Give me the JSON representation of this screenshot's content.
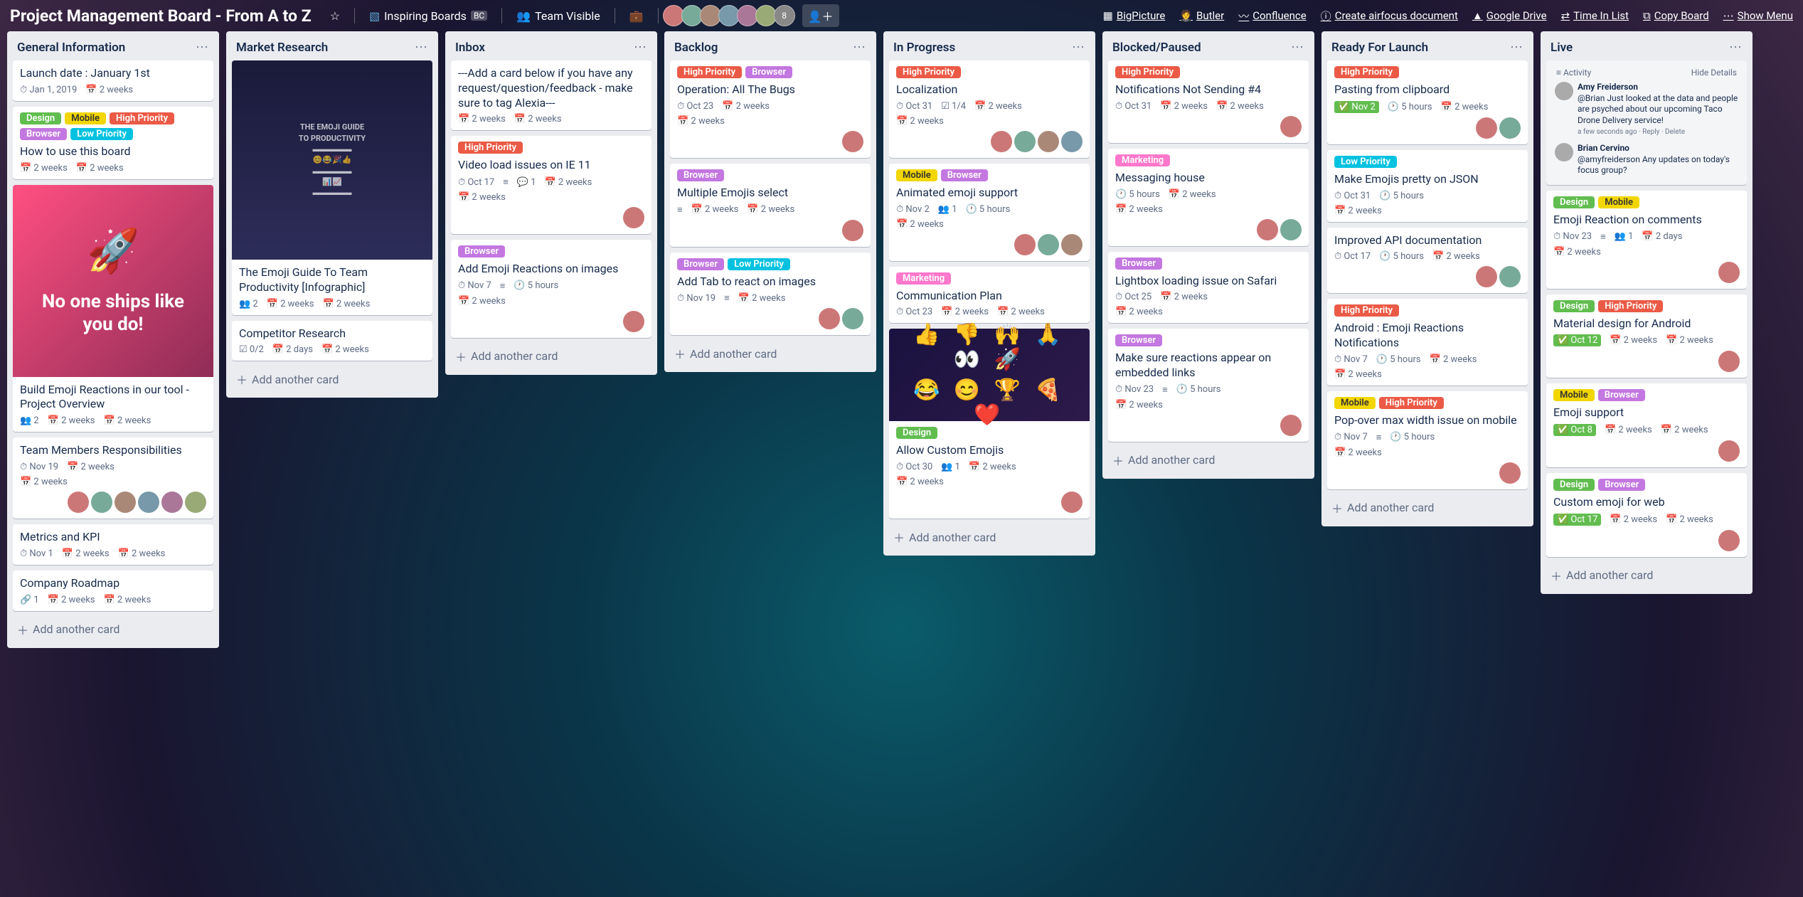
{
  "header": {
    "title": "Project Management Board - From A to Z",
    "team_label": "Inspiring Boards",
    "team_badge": "BC",
    "visibility": "Team Visible",
    "member_count_badge": "8",
    "links": [
      "BigPicture",
      "Butler",
      "Confluence",
      "Create airfocus document",
      "Google Drive",
      "Time In List",
      "Copy Board"
    ],
    "show_menu": "Show Menu"
  },
  "add_label": "Add another card",
  "lists": [
    {
      "title": "General Information",
      "cards": [
        {
          "title": "Launch date : January 1st",
          "badges": [
            "⏱ Jan 1, 2019",
            "📅 2 weeks"
          ]
        },
        {
          "labels": [
            "design",
            "mobile",
            "highpriority",
            "browser",
            "lowpriority"
          ],
          "title": "How to use this board",
          "badges": [
            "📅 2 weeks",
            "📅 2 weeks"
          ]
        },
        {
          "cover": "rocket",
          "cover_text": "No one ships like you do!",
          "title": "Build Emoji Reactions in our tool - Project Overview",
          "badges": [
            "👥 2",
            "📅 2 weeks",
            "📅 2 weeks"
          ]
        },
        {
          "title": "Team Members Responsibilities",
          "badges": [
            "⏱ Nov 19",
            "📅 2 weeks"
          ],
          "badges2": [
            "📅 2 weeks"
          ],
          "members": 6
        },
        {
          "title": "Metrics and KPI",
          "badges": [
            "⏱ Nov 1",
            "📅 2 weeks",
            "📅 2 weeks"
          ]
        },
        {
          "title": "Company Roadmap",
          "badges": [
            "🔗 1",
            "📅 2 weeks",
            "📅 2 weeks"
          ]
        }
      ]
    },
    {
      "title": "Market Research",
      "cards": [
        {
          "cover": "info",
          "title": "The Emoji Guide To Team Productivity [Infographic]",
          "badges": [
            "👥 2",
            "📅 2 weeks",
            "📅 2 weeks"
          ]
        },
        {
          "title": "Competitor Research",
          "badges": [
            "☑ 0/2",
            "📅 2 days",
            "📅 2 weeks"
          ]
        }
      ]
    },
    {
      "title": "Inbox",
      "cards": [
        {
          "title": "---Add a card below if you have any request/question/feedback - make sure to tag Alexia---",
          "badges": [
            "📅 2 weeks",
            "📅 2 weeks"
          ]
        },
        {
          "labels": [
            "highpriority"
          ],
          "title": "Video load issues on IE 11",
          "badges": [
            "⏱ Oct 17",
            "≡",
            "💬 1",
            "📅 2 weeks"
          ],
          "badges2": [
            "📅 2 weeks"
          ],
          "members": 1
        },
        {
          "labels": [
            "browser"
          ],
          "title": "Add Emoji Reactions on images",
          "badges": [
            "⏱ Nov 7",
            "≡",
            "🕐 5 hours"
          ],
          "badges2": [
            "📅 2 weeks"
          ],
          "members": 1
        }
      ]
    },
    {
      "title": "Backlog",
      "cards": [
        {
          "labels": [
            "highpriority",
            "browser"
          ],
          "title": "Operation: All The Bugs",
          "badges": [
            "⏱ Oct 23",
            "📅 2 weeks"
          ],
          "badges2": [
            "📅 2 weeks"
          ],
          "members": 1
        },
        {
          "labels": [
            "browser"
          ],
          "title": "Multiple Emojis select",
          "badges": [
            "≡",
            "📅 2 weeks",
            "📅 2 weeks"
          ],
          "members": 1
        },
        {
          "labels": [
            "browser",
            "lowpriority"
          ],
          "title": "Add Tab to react on images",
          "badges": [
            "⏱ Nov 19",
            "≡",
            "📅 2 weeks"
          ],
          "members": 2
        }
      ]
    },
    {
      "title": "In Progress",
      "cards": [
        {
          "labels": [
            "highpriority"
          ],
          "title": "Localization",
          "badges": [
            "⏱ Oct 31",
            "☑ 1/4",
            "📅 2 weeks"
          ],
          "badges2": [
            "📅 2 weeks"
          ],
          "members": 4
        },
        {
          "labels": [
            "mobile",
            "browser"
          ],
          "title": "Animated emoji support",
          "badges": [
            "⏱ Nov 2",
            "👥 1",
            "🕐 5 hours"
          ],
          "badges2": [
            "📅 2 weeks"
          ],
          "members": 3
        },
        {
          "labels": [
            "marketing"
          ],
          "title": "Communication Plan",
          "badges": [
            "⏱ Oct 23",
            "📅 2 weeks",
            "📅 2 weeks"
          ]
        },
        {
          "cover": "emojis",
          "labels": [
            "design"
          ],
          "title": "Allow Custom Emojis",
          "badges": [
            "⏱ Oct 30",
            "👥 1",
            "📅 2 weeks"
          ],
          "badges2": [
            "📅 2 weeks"
          ],
          "members": 1
        }
      ]
    },
    {
      "title": "Blocked/Paused",
      "cards": [
        {
          "labels": [
            "highpriority"
          ],
          "title": "Notifications Not Sending #4",
          "badges": [
            "⏱ Oct 31",
            "📅 2 weeks",
            "📅 2 weeks"
          ],
          "members": 1
        },
        {
          "labels": [
            "marketing"
          ],
          "title": "Messaging house",
          "badges": [
            "🕐 5 hours",
            "📅 2 weeks"
          ],
          "badges2": [
            "📅 2 weeks"
          ],
          "members": 2
        },
        {
          "labels": [
            "browser"
          ],
          "title": "Lightbox loading issue on Safari",
          "badges": [
            "⏱ Oct 25",
            "📅 2 weeks"
          ],
          "badges2": [
            "📅 2 weeks"
          ]
        },
        {
          "labels": [
            "browser"
          ],
          "title": "Make sure reactions appear on embedded links",
          "badges": [
            "⏱ Nov 23",
            "≡",
            "🕐 5 hours"
          ],
          "badges2": [
            "📅 2 weeks"
          ],
          "members": 1
        }
      ]
    },
    {
      "title": "Ready For Launch",
      "cards": [
        {
          "labels": [
            "highpriority"
          ],
          "title": "Pasting from clipboard",
          "badges": [
            "✅ Nov 2",
            "🕐 5 hours",
            "📅 2 weeks"
          ],
          "due_green": true,
          "members": 2
        },
        {
          "labels": [
            "lowpriority"
          ],
          "title": "Make Emojis pretty on JSON",
          "badges": [
            "⏱ Oct 31",
            "🕐 5 hours"
          ],
          "badges2": [
            "📅 2 weeks"
          ]
        },
        {
          "title": "Improved API documentation",
          "badges": [
            "⏱ Oct 17",
            "🕐 5 hours",
            "📅 2 weeks"
          ],
          "members": 2
        },
        {
          "labels": [
            "highpriority"
          ],
          "title": "Android : Emoji Reactions Notifications",
          "badges": [
            "⏱ Nov 7",
            "🕐 5 hours",
            "📅 2 weeks"
          ],
          "badges2": [
            "📅 2 weeks"
          ]
        },
        {
          "labels": [
            "mobile",
            "highpriority"
          ],
          "title": "Pop-over max width issue on mobile",
          "badges": [
            "⏱ Nov 7",
            "≡",
            "🕐 5 hours"
          ],
          "badges2": [
            "📅 2 weeks"
          ],
          "members": 1
        }
      ]
    },
    {
      "title": "Live",
      "cards": [
        {
          "activity": true,
          "activity_header": "Activity",
          "activity_hide": "Hide Details",
          "comments": [
            {
              "name": "Amy Freiderson",
              "text": "@Brian Just looked at the data and people are psyched about our upcoming Taco Drone Delivery service!",
              "meta": "a few seconds ago · Reply · Delete"
            },
            {
              "name": "Brian Cervino",
              "text": "@amyfreiderson Any updates on today's focus group?"
            }
          ]
        },
        {
          "labels": [
            "design",
            "mobile"
          ],
          "title": "Emoji Reaction on comments",
          "badges": [
            "⏱ Nov 23",
            "≡",
            "👥 1",
            "📅 2 days"
          ],
          "badges2": [
            "📅 2 weeks"
          ],
          "members": 1
        },
        {
          "labels": [
            "design",
            "highpriority"
          ],
          "title": "Material design for Android",
          "badges": [
            "✅ Oct 12",
            "📅 2 weeks",
            "📅 2 weeks"
          ],
          "due_green": true,
          "members": 1
        },
        {
          "labels": [
            "mobile",
            "browser"
          ],
          "title": "Emoji support",
          "badges": [
            "✅ Oct 8",
            "📅 2 weeks",
            "📅 2 weeks"
          ],
          "due_green": true,
          "members": 1
        },
        {
          "labels": [
            "design",
            "browser"
          ],
          "title": "Custom emoji for web",
          "badges": [
            "✅ Oct 17",
            "📅 2 weeks",
            "📅 2 weeks"
          ],
          "due_green": true,
          "members": 1
        }
      ]
    }
  ],
  "label_text": {
    "design": "Design",
    "mobile": "Mobile",
    "highpriority": "High Priority",
    "browser": "Browser",
    "lowpriority": "Low Priority",
    "marketing": "Marketing"
  }
}
